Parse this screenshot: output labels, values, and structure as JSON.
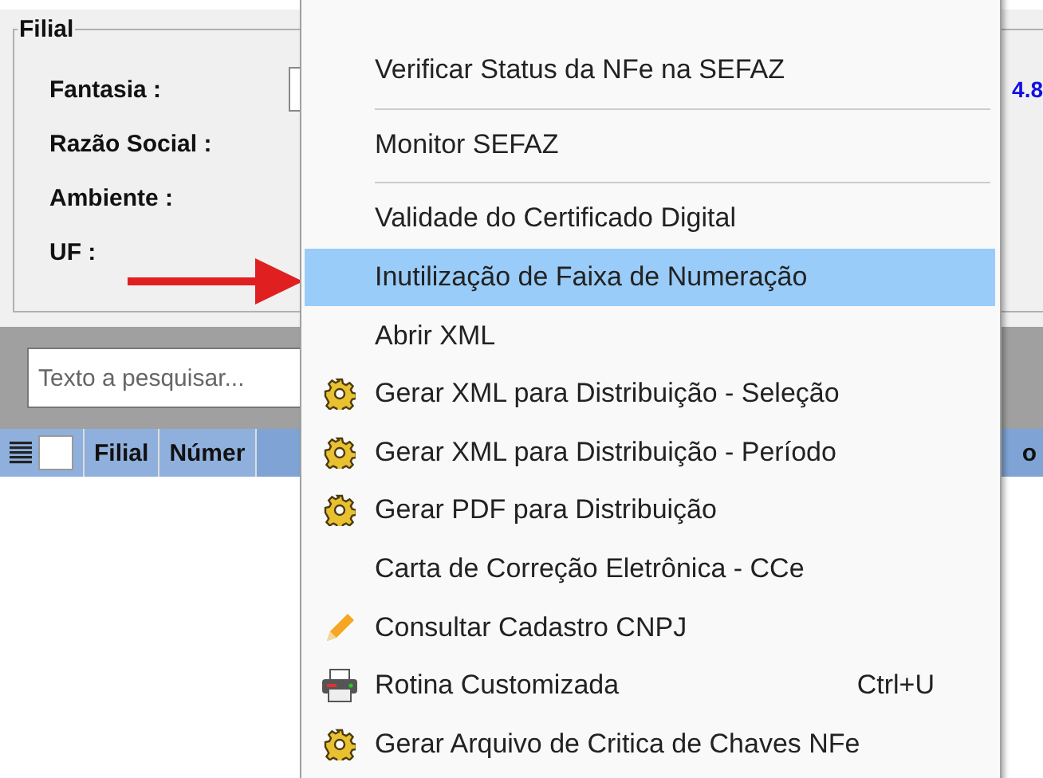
{
  "group": {
    "title": "Filial",
    "fields": [
      {
        "label": "Fantasia :",
        "kind": "input",
        "extra": "4.8"
      },
      {
        "label": "Razão Social :",
        "kind": "text"
      },
      {
        "label": "Ambiente :",
        "kind": "text"
      },
      {
        "label": "UF :",
        "kind": "text"
      }
    ]
  },
  "search": {
    "placeholder": "Texto a pesquisar..."
  },
  "table": {
    "select_all": {
      "checked": false
    },
    "columns": [
      "Filial",
      "Númer"
    ],
    "column_3": "o"
  },
  "context_menu": {
    "items": [
      {
        "kind": "plain",
        "label": "Verificar Status da NFe na SEFAZ",
        "selected": false
      },
      {
        "kind": "separator"
      },
      {
        "kind": "plain",
        "label": "Monitor SEFAZ",
        "selected": false
      },
      {
        "kind": "separator"
      },
      {
        "kind": "plain",
        "label": "Validade do Certificado Digital",
        "selected": false
      },
      {
        "kind": "plain",
        "label": "Inutilização de Faixa de Numeração",
        "selected": true
      },
      {
        "kind": "plain",
        "label": "Abrir XML",
        "selected": false
      },
      {
        "kind": "gear",
        "label": "Gerar XML para Distribuição - Seleção",
        "selected": false
      },
      {
        "kind": "gear",
        "label": "Gerar XML para Distribuição - Período",
        "selected": false
      },
      {
        "kind": "gear",
        "label": "Gerar PDF para Distribuição",
        "selected": false
      },
      {
        "kind": "plain",
        "label": "Carta de Correção Eletrônica - CCe",
        "selected": false
      },
      {
        "kind": "pencil",
        "label": "Consultar Cadastro CNPJ",
        "selected": false
      },
      {
        "kind": "printer",
        "label": "Rotina Customizada",
        "selected": false,
        "shortcut": "Ctrl+U"
      },
      {
        "kind": "gear",
        "label": "Gerar Arquivo de Critica de Chaves NFe",
        "selected": false
      }
    ]
  }
}
